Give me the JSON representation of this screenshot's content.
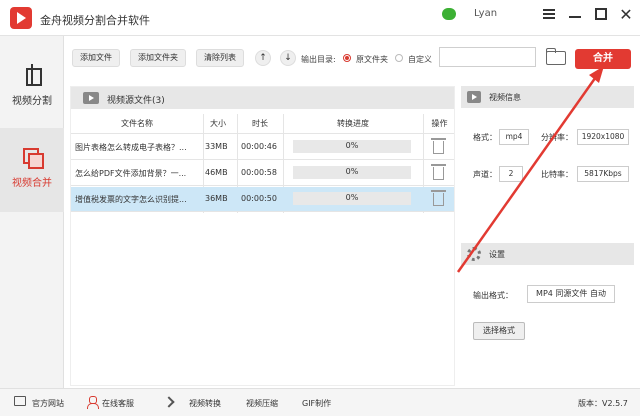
{
  "app": {
    "title": "金舟视频分割合并软件",
    "user": "Lyan",
    "version": "版本：V2.5.7"
  },
  "sidebar": {
    "items": [
      {
        "label": "视频分割",
        "active": false
      },
      {
        "label": "视频合并",
        "active": true
      }
    ]
  },
  "toolbar": {
    "add_file": "添加文件",
    "add_folder": "添加文件夹",
    "clear_list": "清除列表",
    "output_dir_label": "输出目录:",
    "source_folder": "原文件夹",
    "custom": "自定义",
    "path_value": "",
    "merge": "合并"
  },
  "file_list": {
    "title": "视频源文件(3)",
    "columns": [
      "文件名称",
      "大小",
      "时长",
      "转换进度",
      "操作"
    ],
    "rows": [
      {
        "name": "图片表格怎么转成电子表格？...",
        "size": "33MB",
        "duration": "00:00:46",
        "progress": 0,
        "progress_text": "0%"
      },
      {
        "name": "怎么给PDF文件添加背景？一...",
        "size": "46MB",
        "duration": "00:00:58",
        "progress": 0,
        "progress_text": "0%"
      },
      {
        "name": "增值税发票的文字怎么识别提...",
        "size": "36MB",
        "duration": "00:00:50",
        "progress": 0,
        "progress_text": "0%"
      }
    ]
  },
  "video_info": {
    "title": "视频信息",
    "format_label": "格式：",
    "format": "mp4",
    "resolution_label": "分辨率：",
    "resolution": "1920x1080",
    "channels_label": "声道：",
    "channels": "2",
    "bitrate_label": "比特率：",
    "bitrate": "5817Kbps"
  },
  "settings": {
    "title": "设置",
    "output_format_label": "输出格式：",
    "output_format": "MP4 同源文件 自动",
    "choose_format": "选择格式"
  },
  "bottom": {
    "official_site": "官方网站",
    "online_support": "在线客服",
    "video_convert": "视频转换",
    "video_compress": "视频压缩",
    "gif_make": "GIF制作"
  },
  "colors": {
    "accent": "#e23a32",
    "progress": "#3a9be0",
    "selected_row": "#cde7f7"
  }
}
